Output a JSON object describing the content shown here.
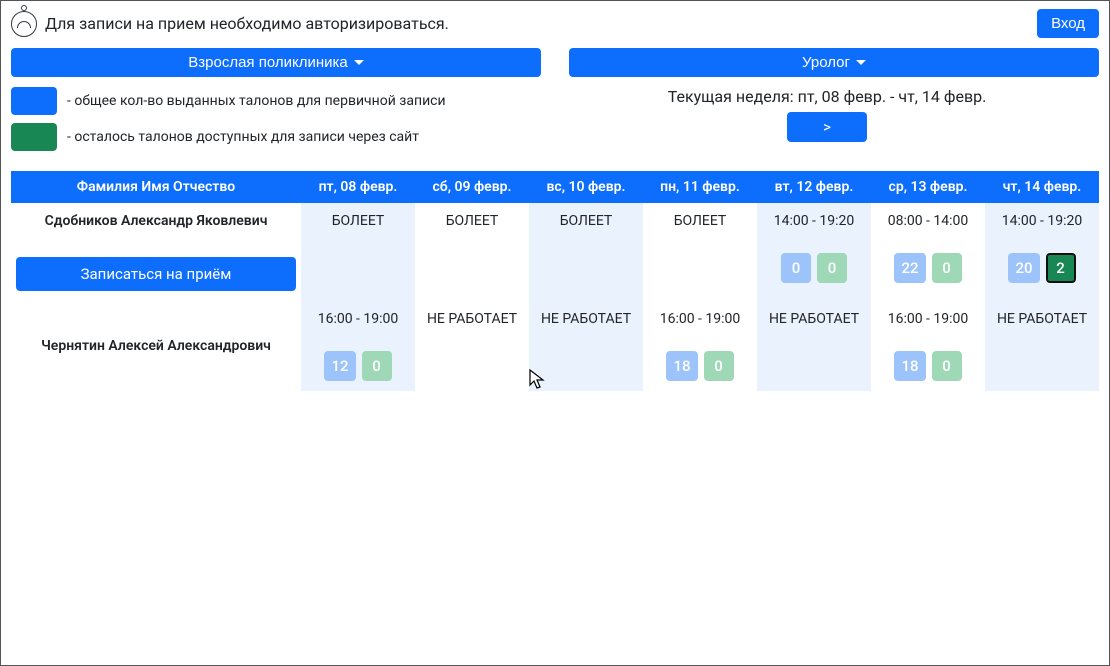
{
  "header": {
    "auth_notice": "Для записи на прием необходимо авторизироваться.",
    "login_btn": "Вход"
  },
  "filters": {
    "clinic": "Взрослая поликлиника",
    "specialty": "Уролог"
  },
  "legend": {
    "issued": "- общее кол-во выданных талонов для первичной записи",
    "available": "- осталось талонов доступных для записи через сайт"
  },
  "week": {
    "label": "Текущая неделя: пт, 08 февр. - чт, 14 февр.",
    "next_symbol": ">"
  },
  "columns": {
    "name": "Фамилия Имя Отчество",
    "d0": "пт, 08 февр.",
    "d1": "сб, 09 февр.",
    "d2": "вс, 10 февр.",
    "d3": "пн, 11 февр.",
    "d4": "вт, 12 февр.",
    "d5": "ср, 13 февр.",
    "d6": "чт, 14 февр."
  },
  "status": {
    "sick": "БОЛЕЕТ",
    "off": "НЕ РАБОТАЕТ"
  },
  "doctors": [
    {
      "name": "Сдобников Александр Яковлевич",
      "book_label": "Записаться на приём",
      "days": [
        {
          "text_key": "status.sick"
        },
        {
          "text_key": "status.sick",
          "white": true
        },
        {
          "text_key": "status.sick"
        },
        {
          "text_key": "status.sick",
          "white": true
        },
        {
          "time": "14:00 - 19:20",
          "issued": "0",
          "avail": "0"
        },
        {
          "time": "08:00 - 14:00",
          "issued": "22",
          "avail": "0",
          "white": true
        },
        {
          "time": "14:00 - 19:20",
          "issued": "20",
          "avail": "2",
          "avail_active": true
        }
      ]
    },
    {
      "name": "Чернятин Алексей Александрович",
      "days": [
        {
          "time": "16:00 - 19:00",
          "issued": "12",
          "avail": "0"
        },
        {
          "text_key": "status.off",
          "white": true
        },
        {
          "text_key": "status.off"
        },
        {
          "time": "16:00 - 19:00",
          "issued": "18",
          "avail": "0",
          "white": true
        },
        {
          "text_key": "status.off"
        },
        {
          "time": "16:00 - 19:00",
          "issued": "18",
          "avail": "0",
          "white": true
        },
        {
          "text_key": "status.off"
        }
      ]
    }
  ]
}
